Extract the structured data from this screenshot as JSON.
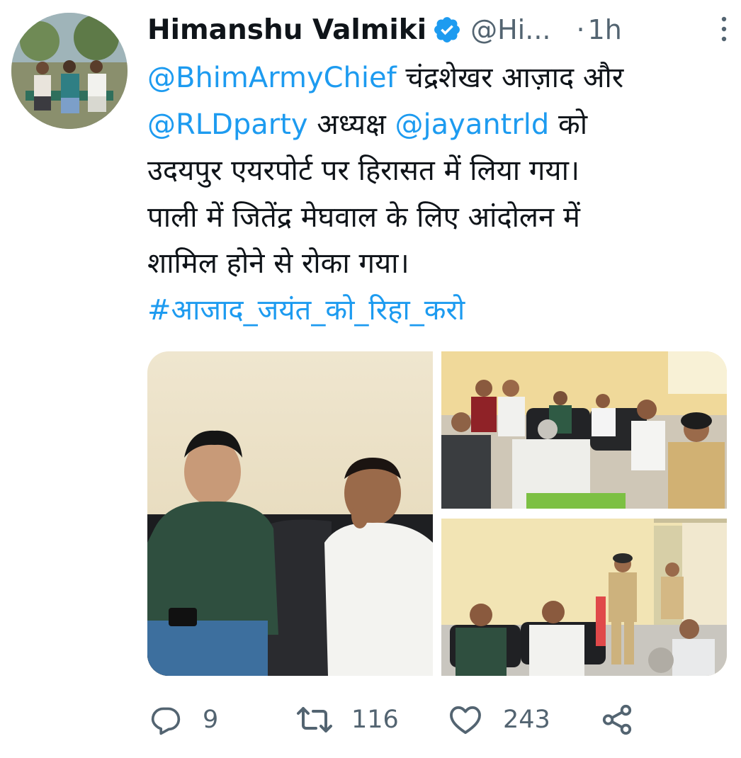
{
  "tweet": {
    "author": {
      "name": "Himanshu Valmiki",
      "handle": "@Hi...",
      "verified_icon": "verified-badge-icon",
      "avatar_icon": "user-avatar-photo"
    },
    "separator": "·",
    "time": "1h",
    "body": {
      "line1": {
        "mention": "@BhimArmyChief",
        "text": " चंद्रशेखर आज़ाद और"
      },
      "line2": {
        "mention1": "@RLDparty",
        "text1": " अध्यक्ष ",
        "mention2": "@jayantrld",
        "text2": " को"
      },
      "line3": "उदयपुर एयरपोर्ट पर हिरासत में लिया गया।",
      "line4": "पाली में जितेंद्र मेघवाल के लिए आंदोलन में",
      "line5": "शामिल होने से रोका गया।",
      "hashtag": "#आजाद_जयंत_को_रिहा_करो"
    },
    "media": [
      {
        "icon": "photo-two-men-on-black-sofa"
      },
      {
        "icon": "photo-group-meeting-with-police-officer"
      },
      {
        "icon": "photo-room-with-police-officers"
      }
    ],
    "actions": {
      "reply": {
        "icon": "reply-icon",
        "count": "9"
      },
      "retweet": {
        "icon": "retweet-icon",
        "count": "116"
      },
      "like": {
        "icon": "heart-icon",
        "count": "243"
      },
      "share": {
        "icon": "share-icon"
      }
    }
  },
  "colors": {
    "link": "#1d9bf0",
    "text": "#0f1419",
    "secondary": "#536471",
    "background": "#ffffff"
  }
}
